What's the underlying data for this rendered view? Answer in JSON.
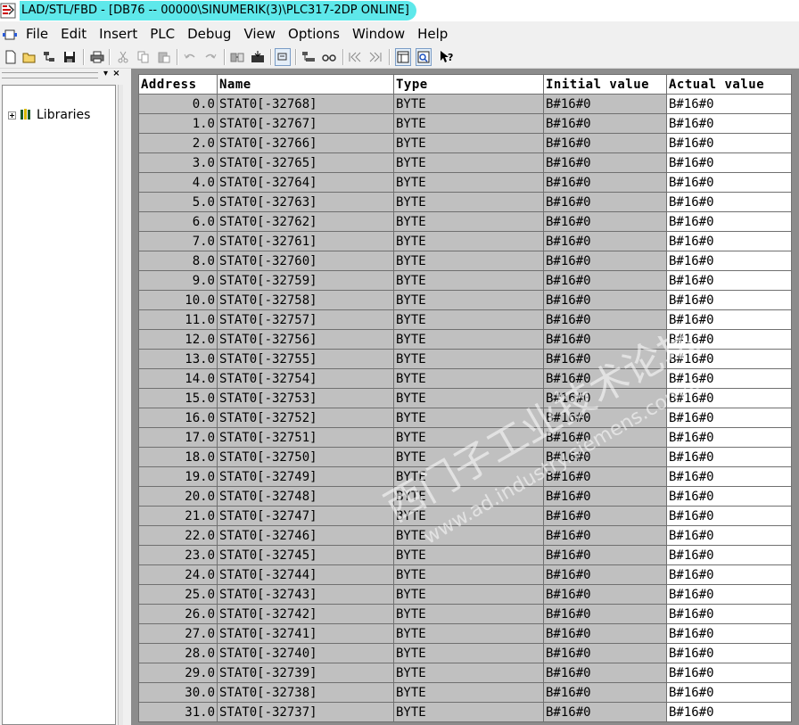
{
  "window": {
    "title": "LAD/STL/FBD  - [DB76 -- 00000\\SINUMERIK(3)\\PLC317-2DP  ONLINE]"
  },
  "menu": [
    "File",
    "Edit",
    "Insert",
    "PLC",
    "Debug",
    "View",
    "Options",
    "Window",
    "Help"
  ],
  "toolbar": {
    "icons": [
      "new-icon",
      "open-icon",
      "accessible-nodes-icon",
      "save-icon",
      "print-icon",
      "cut-icon",
      "copy-icon",
      "paste-icon",
      "undo-icon",
      "redo-icon",
      "load-icon",
      "download-icon",
      "monitor-icon",
      "network-icon",
      "glasses-icon",
      "first-icon",
      "last-icon",
      "overview-icon",
      "details-icon",
      "help-icon"
    ]
  },
  "left_panel": {
    "close_label": "×",
    "tree": [
      {
        "label": "Libraries"
      }
    ]
  },
  "table": {
    "columns": [
      "Address",
      "Name",
      "Type",
      "Initial value",
      "Actual value"
    ],
    "rows": [
      {
        "address": "0.0",
        "name": "STAT0[-32768]",
        "type": "BYTE",
        "initial": "B#16#0",
        "actual": "B#16#0"
      },
      {
        "address": "1.0",
        "name": "STAT0[-32767]",
        "type": "BYTE",
        "initial": "B#16#0",
        "actual": "B#16#0"
      },
      {
        "address": "2.0",
        "name": "STAT0[-32766]",
        "type": "BYTE",
        "initial": "B#16#0",
        "actual": "B#16#0"
      },
      {
        "address": "3.0",
        "name": "STAT0[-32765]",
        "type": "BYTE",
        "initial": "B#16#0",
        "actual": "B#16#0"
      },
      {
        "address": "4.0",
        "name": "STAT0[-32764]",
        "type": "BYTE",
        "initial": "B#16#0",
        "actual": "B#16#0"
      },
      {
        "address": "5.0",
        "name": "STAT0[-32763]",
        "type": "BYTE",
        "initial": "B#16#0",
        "actual": "B#16#0"
      },
      {
        "address": "6.0",
        "name": "STAT0[-32762]",
        "type": "BYTE",
        "initial": "B#16#0",
        "actual": "B#16#0"
      },
      {
        "address": "7.0",
        "name": "STAT0[-32761]",
        "type": "BYTE",
        "initial": "B#16#0",
        "actual": "B#16#0"
      },
      {
        "address": "8.0",
        "name": "STAT0[-32760]",
        "type": "BYTE",
        "initial": "B#16#0",
        "actual": "B#16#0"
      },
      {
        "address": "9.0",
        "name": "STAT0[-32759]",
        "type": "BYTE",
        "initial": "B#16#0",
        "actual": "B#16#0"
      },
      {
        "address": "10.0",
        "name": "STAT0[-32758]",
        "type": "BYTE",
        "initial": "B#16#0",
        "actual": "B#16#0"
      },
      {
        "address": "11.0",
        "name": "STAT0[-32757]",
        "type": "BYTE",
        "initial": "B#16#0",
        "actual": "B#16#0"
      },
      {
        "address": "12.0",
        "name": "STAT0[-32756]",
        "type": "BYTE",
        "initial": "B#16#0",
        "actual": "B#16#0"
      },
      {
        "address": "13.0",
        "name": "STAT0[-32755]",
        "type": "BYTE",
        "initial": "B#16#0",
        "actual": "B#16#0"
      },
      {
        "address": "14.0",
        "name": "STAT0[-32754]",
        "type": "BYTE",
        "initial": "B#16#0",
        "actual": "B#16#0"
      },
      {
        "address": "15.0",
        "name": "STAT0[-32753]",
        "type": "BYTE",
        "initial": "B#16#0",
        "actual": "B#16#0"
      },
      {
        "address": "16.0",
        "name": "STAT0[-32752]",
        "type": "BYTE",
        "initial": "B#16#0",
        "actual": "B#16#0"
      },
      {
        "address": "17.0",
        "name": "STAT0[-32751]",
        "type": "BYTE",
        "initial": "B#16#0",
        "actual": "B#16#0"
      },
      {
        "address": "18.0",
        "name": "STAT0[-32750]",
        "type": "BYTE",
        "initial": "B#16#0",
        "actual": "B#16#0"
      },
      {
        "address": "19.0",
        "name": "STAT0[-32749]",
        "type": "BYTE",
        "initial": "B#16#0",
        "actual": "B#16#0"
      },
      {
        "address": "20.0",
        "name": "STAT0[-32748]",
        "type": "BYTE",
        "initial": "B#16#0",
        "actual": "B#16#0"
      },
      {
        "address": "21.0",
        "name": "STAT0[-32747]",
        "type": "BYTE",
        "initial": "B#16#0",
        "actual": "B#16#0"
      },
      {
        "address": "22.0",
        "name": "STAT0[-32746]",
        "type": "BYTE",
        "initial": "B#16#0",
        "actual": "B#16#0"
      },
      {
        "address": "23.0",
        "name": "STAT0[-32745]",
        "type": "BYTE",
        "initial": "B#16#0",
        "actual": "B#16#0"
      },
      {
        "address": "24.0",
        "name": "STAT0[-32744]",
        "type": "BYTE",
        "initial": "B#16#0",
        "actual": "B#16#0"
      },
      {
        "address": "25.0",
        "name": "STAT0[-32743]",
        "type": "BYTE",
        "initial": "B#16#0",
        "actual": "B#16#0"
      },
      {
        "address": "26.0",
        "name": "STAT0[-32742]",
        "type": "BYTE",
        "initial": "B#16#0",
        "actual": "B#16#0"
      },
      {
        "address": "27.0",
        "name": "STAT0[-32741]",
        "type": "BYTE",
        "initial": "B#16#0",
        "actual": "B#16#0"
      },
      {
        "address": "28.0",
        "name": "STAT0[-32740]",
        "type": "BYTE",
        "initial": "B#16#0",
        "actual": "B#16#0"
      },
      {
        "address": "29.0",
        "name": "STAT0[-32739]",
        "type": "BYTE",
        "initial": "B#16#0",
        "actual": "B#16#0"
      },
      {
        "address": "30.0",
        "name": "STAT0[-32738]",
        "type": "BYTE",
        "initial": "B#16#0",
        "actual": "B#16#0"
      },
      {
        "address": "31.0",
        "name": "STAT0[-32737]",
        "type": "BYTE",
        "initial": "B#16#0",
        "actual": "B#16#0"
      }
    ]
  },
  "watermark": {
    "line1": "西门子工业技术论坛",
    "line2": "www.ad.industry.siemens.com/c",
    "color": "#ffffff"
  },
  "colors": {
    "title_highlight": "#5ee8ea",
    "table_cell": "#c0c0c0",
    "table_bg": "#8c8c8c"
  }
}
